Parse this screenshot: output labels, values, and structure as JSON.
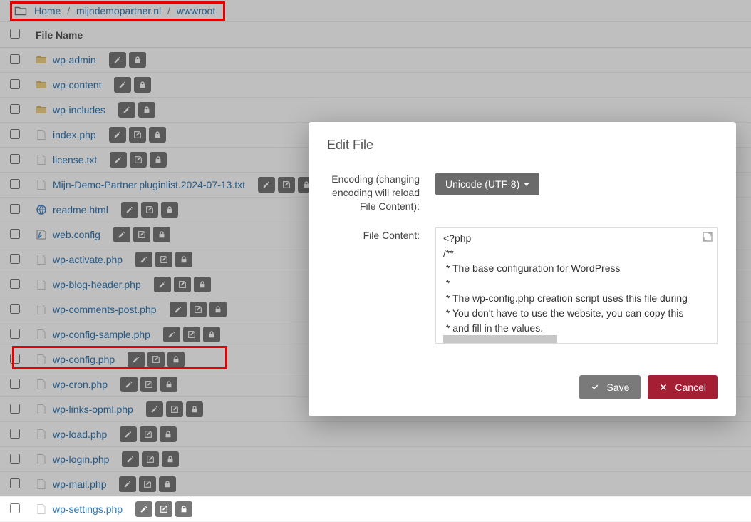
{
  "breadcrumb": {
    "items": [
      "Home",
      "mijndemopartner.nl",
      "wwwroot"
    ]
  },
  "table": {
    "header": "File Name"
  },
  "files": [
    {
      "name": "wp-admin",
      "type": "folder",
      "actions": [
        "edit",
        "lock"
      ]
    },
    {
      "name": "wp-content",
      "type": "folder",
      "actions": [
        "edit",
        "lock"
      ]
    },
    {
      "name": "wp-includes",
      "type": "folder",
      "actions": [
        "edit",
        "lock"
      ]
    },
    {
      "name": "index.php",
      "type": "file",
      "actions": [
        "edit",
        "editfile",
        "lock"
      ]
    },
    {
      "name": "license.txt",
      "type": "file",
      "actions": [
        "edit",
        "editfile",
        "lock"
      ]
    },
    {
      "name": "Mijn-Demo-Partner.pluginlist.2024-07-13.txt",
      "type": "file",
      "actions": [
        "edit",
        "editfile",
        "lock"
      ]
    },
    {
      "name": "readme.html",
      "type": "html",
      "actions": [
        "edit",
        "editfile",
        "lock"
      ]
    },
    {
      "name": "web.config",
      "type": "config",
      "actions": [
        "edit",
        "editfile",
        "lock"
      ]
    },
    {
      "name": "wp-activate.php",
      "type": "file",
      "actions": [
        "edit",
        "editfile",
        "lock"
      ]
    },
    {
      "name": "wp-blog-header.php",
      "type": "file",
      "actions": [
        "edit",
        "editfile",
        "lock"
      ]
    },
    {
      "name": "wp-comments-post.php",
      "type": "file",
      "actions": [
        "edit",
        "editfile",
        "lock"
      ]
    },
    {
      "name": "wp-config-sample.php",
      "type": "file",
      "actions": [
        "edit",
        "editfile",
        "lock"
      ]
    },
    {
      "name": "wp-config.php",
      "type": "file",
      "actions": [
        "edit",
        "editfile",
        "lock"
      ],
      "highlight": true
    },
    {
      "name": "wp-cron.php",
      "type": "file",
      "actions": [
        "edit",
        "editfile",
        "lock"
      ]
    },
    {
      "name": "wp-links-opml.php",
      "type": "file",
      "actions": [
        "edit",
        "editfile",
        "lock"
      ]
    },
    {
      "name": "wp-load.php",
      "type": "file",
      "actions": [
        "edit",
        "editfile",
        "lock"
      ]
    },
    {
      "name": "wp-login.php",
      "type": "file",
      "actions": [
        "edit",
        "editfile",
        "lock"
      ]
    },
    {
      "name": "wp-mail.php",
      "type": "file",
      "actions": [
        "edit",
        "editfile",
        "lock"
      ]
    },
    {
      "name": "wp-settings.php",
      "type": "file",
      "actions": [
        "edit",
        "editfile",
        "lock"
      ]
    }
  ],
  "modal": {
    "title": "Edit File",
    "encoding_label": "Encoding (changing encoding will reload File Content):",
    "encoding_value": "Unicode (UTF-8)",
    "content_label": "File Content:",
    "content": "<?php\n/**\n * The base configuration for WordPress\n *\n * The wp-config.php creation script uses this file during\n * You don't have to use the website, you can copy this\n * and fill in the values.\n *\n * This file contains the following configurations:\n *",
    "save_label": "Save",
    "cancel_label": "Cancel"
  },
  "icons": {
    "pencil": "pencil",
    "editfile": "edit-square",
    "lock": "lock"
  },
  "colors": {
    "link": "#337ab7",
    "danger": "#a41e34",
    "highlight": "#e60000"
  }
}
